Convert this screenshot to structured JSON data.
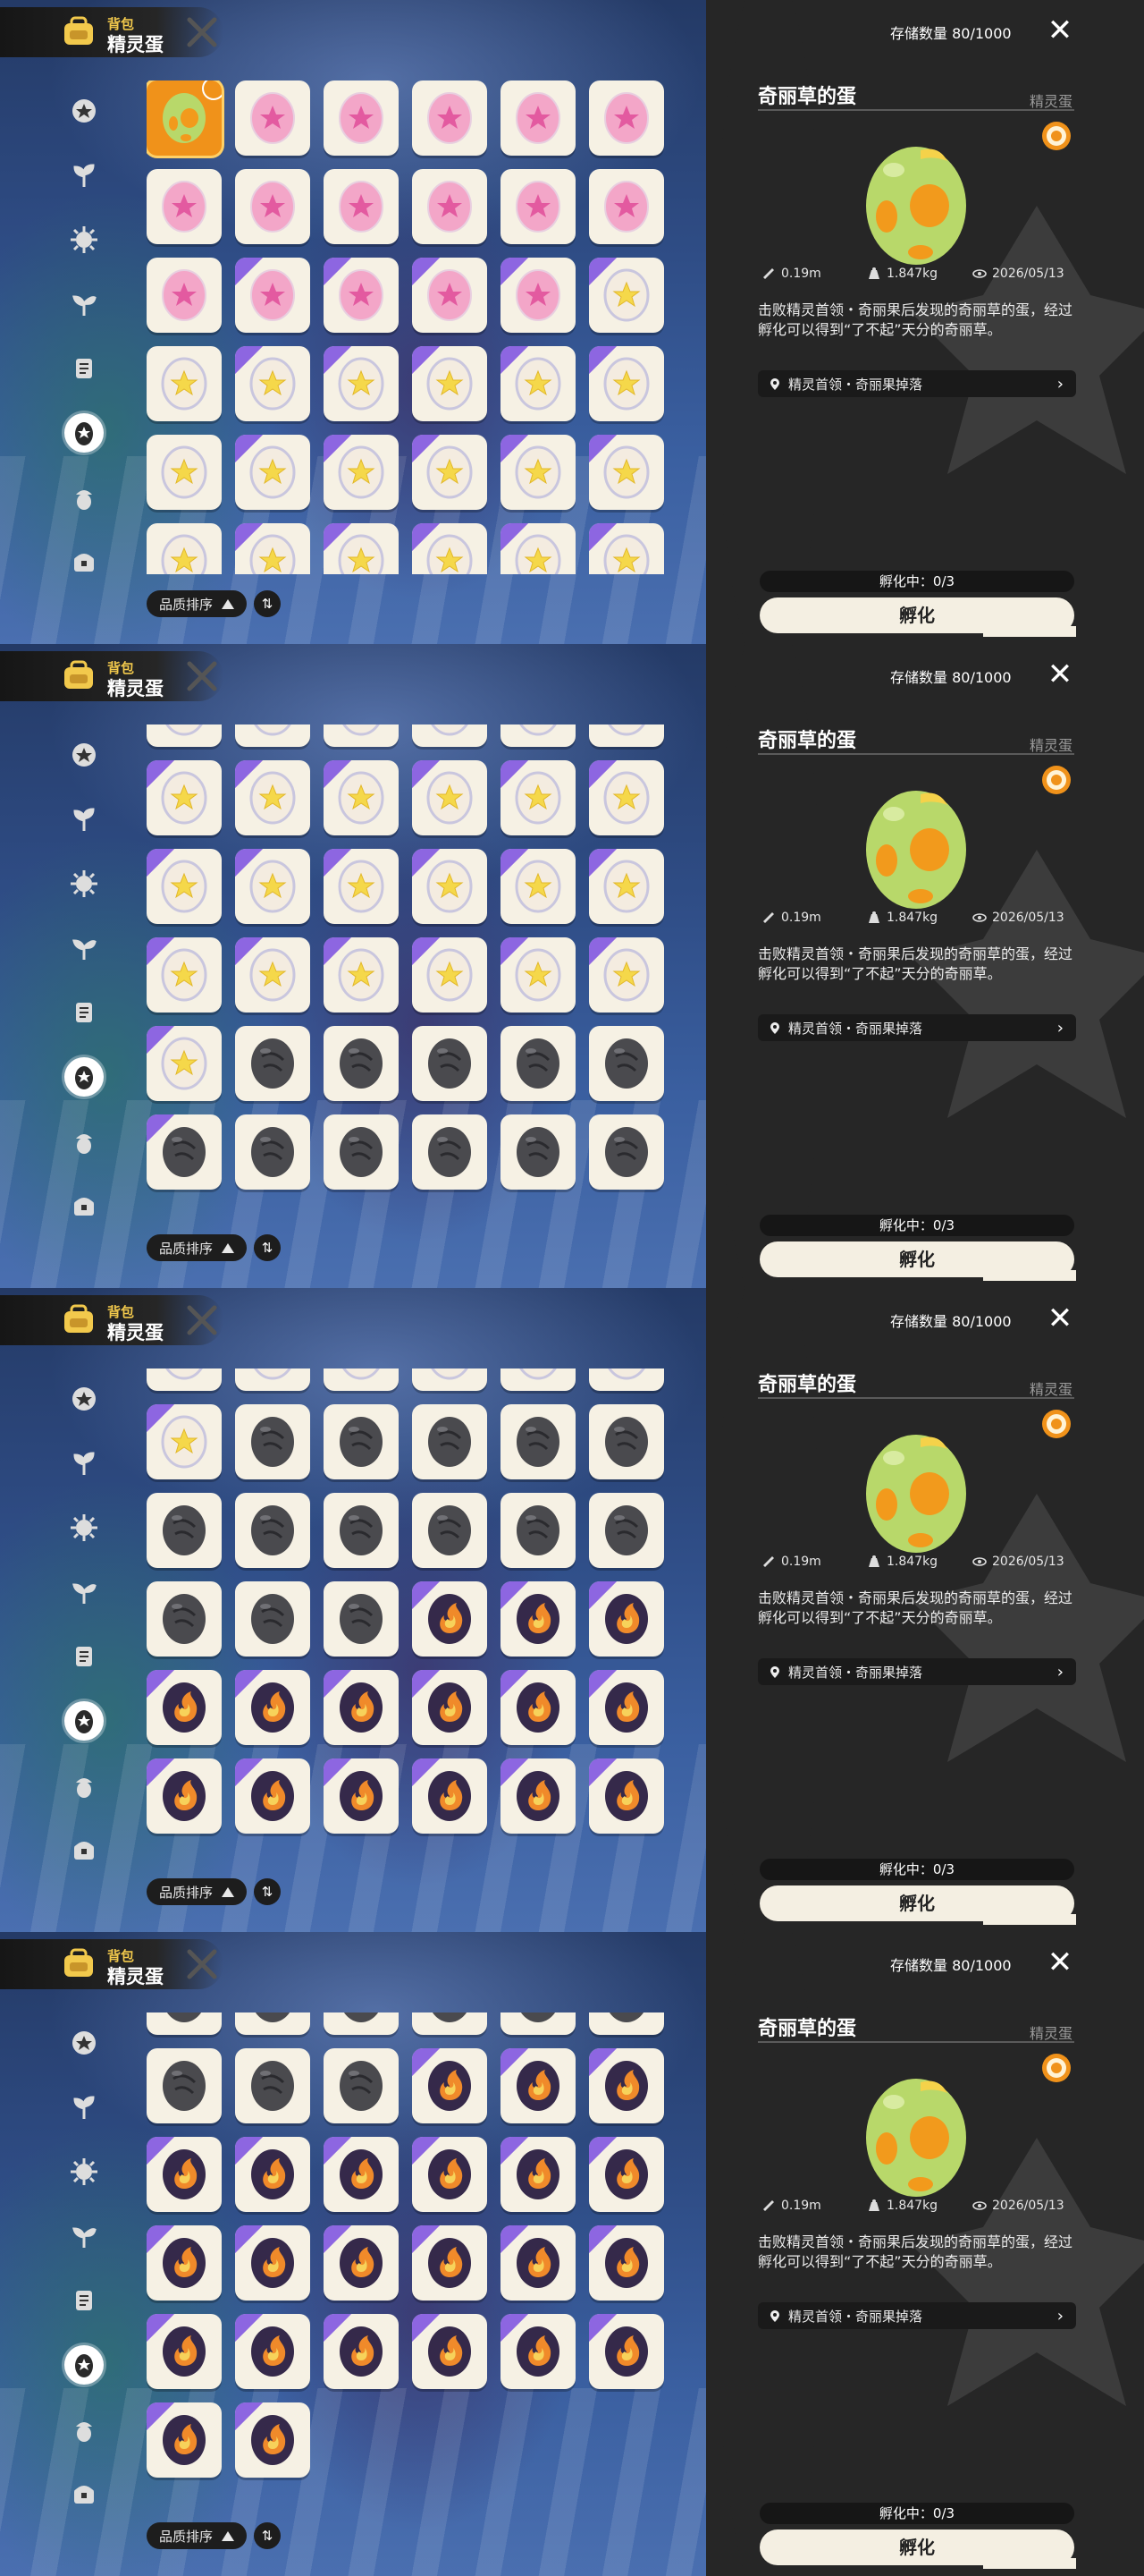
{
  "header": {
    "subtitle": "背包",
    "title": "精灵蛋"
  },
  "sidebar": {
    "items": [
      {
        "icon": "star-badge-icon"
      },
      {
        "icon": "leaf-sprout-icon"
      },
      {
        "icon": "spiky-ball-icon"
      },
      {
        "icon": "sprout-icon"
      },
      {
        "icon": "scroll-icon"
      },
      {
        "icon": "egg-category-icon",
        "active": true
      },
      {
        "icon": "acorn-icon"
      },
      {
        "icon": "chest-icon"
      }
    ]
  },
  "sort": {
    "label": "品质排序",
    "toggle_icon": "sort-toggle-icon"
  },
  "detail": {
    "storage": "存储数量 80/1000",
    "close_icon": "close-icon",
    "name": "奇丽草的蛋",
    "category": "精灵蛋",
    "stats": {
      "size": "0.19m",
      "weight": "1.847kg",
      "date": "2026/05/13"
    },
    "description": "击败精灵首领・奇丽果后发现的奇丽草的蛋，经过孵化可以得到“了不起”天分的奇丽草。",
    "source": "精灵首领・奇丽果掉落",
    "hatching_status": "孵化中：0/3",
    "hatch_button": "孵化"
  },
  "colors": {
    "selected": "#f0921a",
    "panel": "#262626",
    "rare_ribbon": "#7a4ee0",
    "egg_green": "#b8d86a",
    "egg_spot": "#f29a1c"
  },
  "egg_types": {
    "G": "green-orange-spotted-egg",
    "P": "pink-star-egg",
    "Y": "yellow-star-egg",
    "D": "dark-gray-egg",
    "F": "fire-swirl-egg"
  },
  "panels": [
    {
      "offset_rows": 0,
      "rows": [
        [
          "G",
          "P",
          "P",
          "P",
          "P",
          "P"
        ],
        [
          "P",
          "P",
          "P",
          "P",
          "P",
          "P"
        ],
        [
          "P",
          "P",
          "P",
          "P",
          "P",
          "Y"
        ],
        [
          "Y",
          "Y",
          "Y",
          "Y",
          "Y",
          "Y"
        ],
        [
          "Y",
          "Y",
          "Y",
          "Y",
          "Y",
          "Y"
        ],
        [
          "Y",
          "Y",
          "Y",
          "Y",
          "Y",
          "Y"
        ]
      ],
      "ribbons": [
        [
          2,
          1
        ],
        [
          2,
          2
        ],
        [
          2,
          3
        ],
        [
          2,
          4
        ],
        [
          2,
          5
        ],
        [
          3,
          1
        ],
        [
          3,
          2
        ],
        [
          3,
          3
        ],
        [
          3,
          4
        ],
        [
          3,
          5
        ],
        [
          4,
          1
        ],
        [
          4,
          2
        ],
        [
          4,
          3
        ],
        [
          4,
          4
        ],
        [
          4,
          5
        ],
        [
          5,
          1
        ],
        [
          5,
          2
        ],
        [
          5,
          3
        ],
        [
          5,
          4
        ],
        [
          5,
          5
        ]
      ]
    },
    {
      "offset_rows": 0.6,
      "rows": [
        [
          "Y",
          "Y",
          "Y",
          "Y",
          "Y",
          "Y"
        ],
        [
          "Y",
          "Y",
          "Y",
          "Y",
          "Y",
          "Y"
        ],
        [
          "Y",
          "Y",
          "Y",
          "Y",
          "Y",
          "Y"
        ],
        [
          "Y",
          "Y",
          "Y",
          "Y",
          "Y",
          "Y"
        ],
        [
          "Y",
          "D",
          "D",
          "D",
          "D",
          "D"
        ],
        [
          "D",
          "D",
          "D",
          "D",
          "D",
          "D"
        ]
      ],
      "ribbons": [
        [
          0,
          1
        ],
        [
          0,
          2
        ],
        [
          0,
          3
        ],
        [
          0,
          4
        ],
        [
          0,
          5
        ],
        [
          1,
          0
        ],
        [
          1,
          1
        ],
        [
          1,
          2
        ],
        [
          1,
          3
        ],
        [
          1,
          4
        ],
        [
          1,
          5
        ],
        [
          2,
          0
        ],
        [
          2,
          1
        ],
        [
          2,
          2
        ],
        [
          2,
          3
        ],
        [
          2,
          4
        ],
        [
          2,
          5
        ],
        [
          3,
          0
        ],
        [
          3,
          1
        ],
        [
          3,
          2
        ],
        [
          3,
          3
        ],
        [
          3,
          4
        ],
        [
          3,
          5
        ],
        [
          4,
          0
        ],
        [
          5,
          0
        ]
      ]
    },
    {
      "offset_rows": 0.6,
      "rows": [
        [
          "Y",
          "Y",
          "Y",
          "Y",
          "Y",
          "Y"
        ],
        [
          "Y",
          "D",
          "D",
          "D",
          "D",
          "D"
        ],
        [
          "D",
          "D",
          "D",
          "D",
          "D",
          "D"
        ],
        [
          "D",
          "D",
          "D",
          "F",
          "F",
          "F"
        ],
        [
          "F",
          "F",
          "F",
          "F",
          "F",
          "F"
        ],
        [
          "F",
          "F",
          "F",
          "F",
          "F",
          "F"
        ]
      ],
      "ribbons": [
        [
          0,
          0
        ],
        [
          1,
          0
        ],
        [
          3,
          3
        ],
        [
          3,
          4
        ],
        [
          3,
          5
        ],
        [
          4,
          0
        ],
        [
          4,
          1
        ],
        [
          4,
          2
        ],
        [
          4,
          3
        ],
        [
          4,
          4
        ],
        [
          4,
          5
        ],
        [
          5,
          0
        ],
        [
          5,
          1
        ],
        [
          5,
          2
        ],
        [
          5,
          3
        ],
        [
          5,
          4
        ],
        [
          5,
          5
        ]
      ]
    },
    {
      "offset_rows": 0.6,
      "rows": [
        [
          "D",
          "D",
          "D",
          "D",
          "D",
          "D"
        ],
        [
          "D",
          "D",
          "D",
          "F",
          "F",
          "F"
        ],
        [
          "F",
          "F",
          "F",
          "F",
          "F",
          "F"
        ],
        [
          "F",
          "F",
          "F",
          "F",
          "F",
          "F"
        ],
        [
          "F",
          "F",
          "F",
          "F",
          "F",
          "F"
        ],
        [
          "F",
          "F"
        ]
      ],
      "ribbons": [
        [
          1,
          3
        ],
        [
          1,
          4
        ],
        [
          1,
          5
        ],
        [
          2,
          0
        ],
        [
          2,
          1
        ],
        [
          2,
          2
        ],
        [
          2,
          3
        ],
        [
          2,
          4
        ],
        [
          2,
          5
        ],
        [
          3,
          0
        ],
        [
          3,
          1
        ],
        [
          3,
          2
        ],
        [
          3,
          3
        ],
        [
          3,
          4
        ],
        [
          3,
          5
        ],
        [
          4,
          0
        ],
        [
          4,
          1
        ],
        [
          4,
          2
        ],
        [
          4,
          3
        ],
        [
          4,
          4
        ],
        [
          4,
          5
        ],
        [
          5,
          0
        ],
        [
          5,
          1
        ]
      ]
    }
  ],
  "selected_cell": {
    "panel": 0,
    "row": 0,
    "col": 0
  }
}
